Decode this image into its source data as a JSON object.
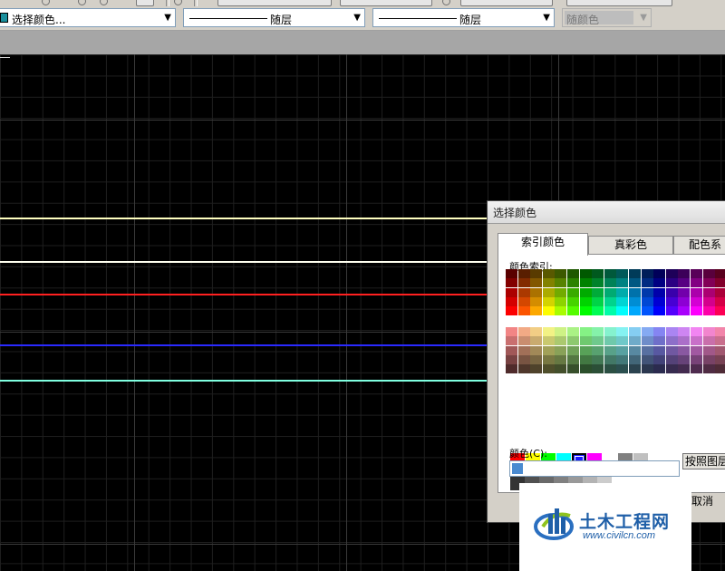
{
  "toolbar": {
    "color_combo": {
      "label": "选择颜色...",
      "swatch_color": "#1a8f9c"
    },
    "linetype_combo": {
      "label": "随层"
    },
    "lineweight_combo": {
      "label": "随层"
    },
    "plotstyle_combo": {
      "label": "随颜色",
      "disabled": true
    }
  },
  "drawing": {
    "background": "#000000",
    "lines": [
      {
        "color": "#ffffc0"
      },
      {
        "color": "#fffff0"
      },
      {
        "color": "#ff2020"
      },
      {
        "color": "#2a2aff"
      },
      {
        "color": "#80ffe0"
      }
    ]
  },
  "dialog": {
    "title": "选择颜色",
    "tabs": [
      {
        "label": "索引颜色",
        "active": true
      },
      {
        "label": "真彩色",
        "active": false
      },
      {
        "label": "配色系",
        "active": false
      }
    ],
    "index_label": "颜色索引:",
    "standard_colors": [
      "#ff0000",
      "#ffff00",
      "#00ff00",
      "#00ffff",
      "#1a1aff",
      "#ff00ff",
      "#ffffff",
      "#808080",
      "#c0c0c0"
    ],
    "selected_standard_index": 4,
    "gray_colors": [
      "#333333",
      "#505050",
      "#696969",
      "#808080",
      "#999999",
      "#b3b3b3",
      "#cccccc",
      "#ffffff"
    ],
    "bylayer_button": "按照图层(",
    "color_label": "颜色(C):",
    "color_value": "",
    "cancel_button": "取消"
  },
  "watermark": {
    "title": "土木工程网",
    "url": "www.civilcn.com"
  }
}
